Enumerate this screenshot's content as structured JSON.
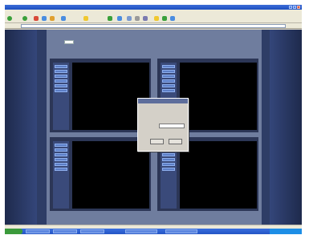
{
  "browser": {
    "title": "",
    "address": "",
    "toolbar_labels": [
      "",
      "",
      ""
    ],
    "status": ""
  },
  "page": {
    "header_label": ""
  },
  "panes": [
    {
      "label": "",
      "menu": [
        "",
        "",
        "",
        "",
        "",
        ""
      ]
    },
    {
      "label": "",
      "menu": [
        "",
        "",
        "",
        "",
        "",
        ""
      ]
    },
    {
      "label": "",
      "menu": [
        "",
        "",
        "",
        "",
        "",
        ""
      ]
    },
    {
      "label": "",
      "menu": [
        "",
        "",
        "",
        "",
        "",
        ""
      ]
    }
  ],
  "dialog": {
    "title": "",
    "message": "",
    "field_label": "",
    "ok_label": "",
    "cancel_label": ""
  },
  "colors": {
    "page_background": "#2e3d66",
    "content_panel": "#6f7d9e",
    "video": "#000000",
    "menu_button": "#5d7fc7",
    "dialog": "#d4d0c8"
  }
}
